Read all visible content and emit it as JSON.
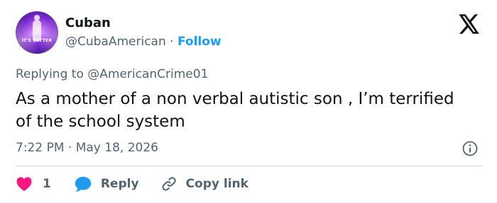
{
  "tweet": {
    "author_name": "Cuban",
    "handle": "@CubaAmerican",
    "separator": "·",
    "follow_label": "Follow",
    "avatar_caption": "IT'S BETTER",
    "replying_prefix": "Replying to",
    "replying_to": "@AmericanCrime01",
    "text": "As a mother of a non verbal autistic son , I’m terrified of the school system",
    "time": "7:22 PM",
    "date": "May 18, 2026"
  },
  "actions": {
    "like_count": "1",
    "reply_label": "Reply",
    "copy_link_label": "Copy link"
  },
  "icons": {
    "logo": "x-logo-icon",
    "info": "info-icon",
    "like": "heart-icon",
    "reply": "speech-bubble-icon",
    "copy": "link-icon"
  },
  "colors": {
    "accent": "#1d9bf0",
    "like": "#f91880",
    "text": "#0f1419",
    "muted": "#536471"
  }
}
